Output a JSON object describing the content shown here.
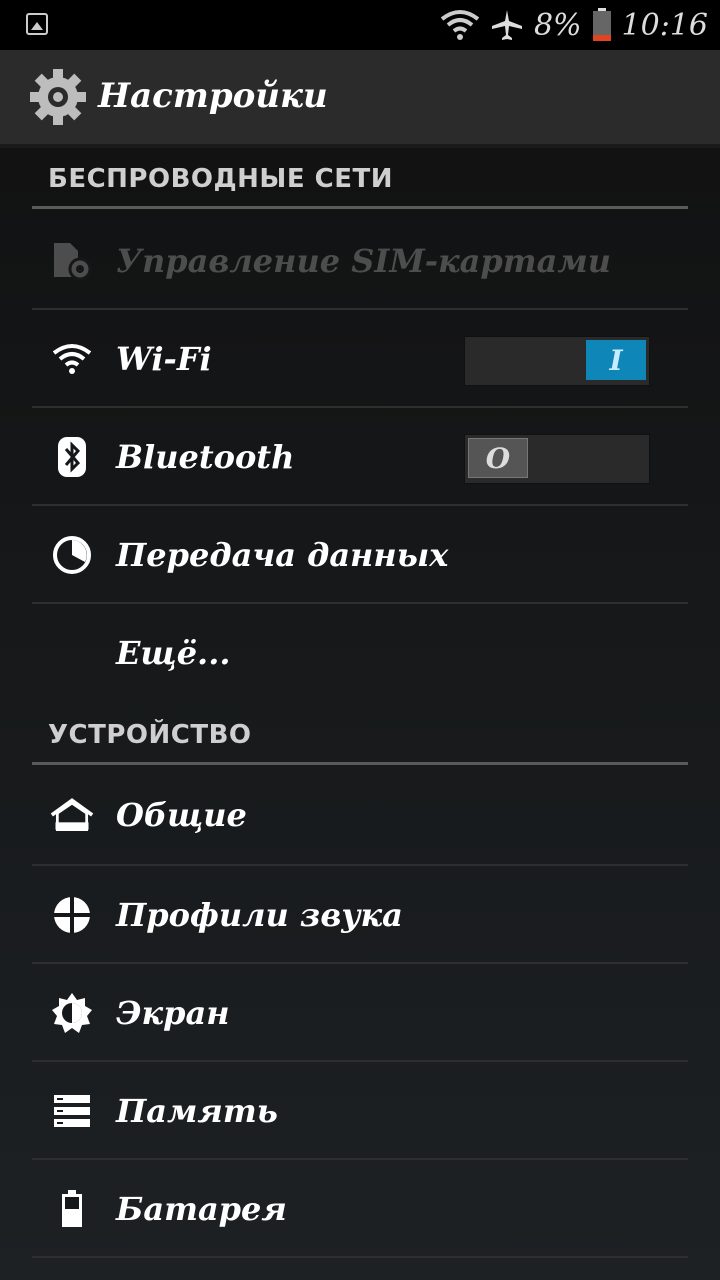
{
  "status_bar": {
    "battery_percent": "8%",
    "time": "10:16",
    "icons": [
      "image-notification-icon",
      "wifi-signal-icon",
      "airplane-icon",
      "battery-icon"
    ]
  },
  "header": {
    "title": "Настройки",
    "icon": "settings-gear-icon"
  },
  "sections": {
    "wireless": "БЕСПРОВОДНЫЕ СЕТИ",
    "device": "УСТРОЙСТВО"
  },
  "items": {
    "sim": "Управление SIM-картами",
    "wifi": "Wi-Fi",
    "wifi_switch": "I",
    "bluetooth": "Bluetooth",
    "bluetooth_switch": "O",
    "data": "Передача данных",
    "more": "Ещё...",
    "general": "Общие",
    "sound": "Профили звука",
    "display": "Экран",
    "storage": "Память",
    "battery": "Батарея"
  },
  "colors": {
    "accent": "#0f86b8",
    "background": "#151719",
    "header": "#2b2b2b",
    "disabled_text": "#4d4d4d"
  }
}
